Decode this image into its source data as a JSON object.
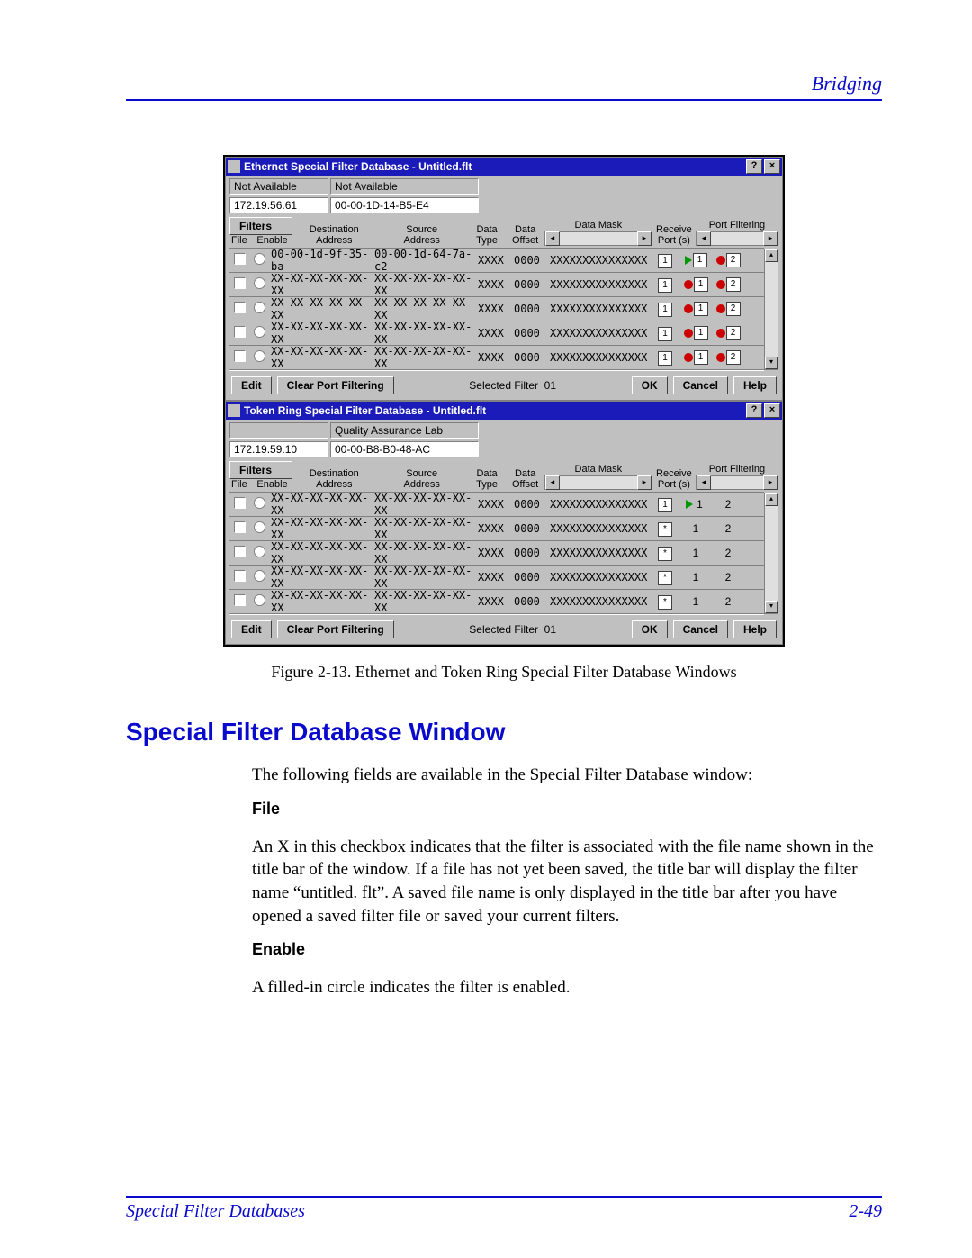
{
  "header": {
    "section": "Bridging"
  },
  "figure_caption": "Figure 2-13. Ethernet and Token Ring Special Filter Database Windows",
  "section_title": "Special Filter Database Window",
  "intro": "The following fields are available in the Special Filter Database window:",
  "fields": {
    "file": {
      "name": "File",
      "desc": "An X in this checkbox indicates that the filter is associated with the file name shown in the title bar of the window. If a file has not yet been saved, the title bar will display the filter name “untitled. flt”. A saved file name is only displayed in the title bar after you have opened a saved filter file or saved your current filters."
    },
    "enable": {
      "name": "Enable",
      "desc": "A filled-in circle indicates the filter is enabled."
    }
  },
  "footer": {
    "left": "Special Filter Databases",
    "right": "2-49"
  },
  "strings": {
    "filters_btn": "Filters",
    "edit_btn": "Edit",
    "clear_btn": "Clear Port Filtering",
    "ok_btn": "OK",
    "cancel_btn": "Cancel",
    "help_btn": "Help",
    "selected_label": "Selected Filter",
    "selected_value": "01",
    "hdr_file": "File",
    "hdr_enable": "Enable",
    "hdr_dest1": "Destination",
    "hdr_dest2": "Address",
    "hdr_src1": "Source",
    "hdr_src2": "Address",
    "hdr_dtype1": "Data",
    "hdr_dtype2": "Type",
    "hdr_doff1": "Data",
    "hdr_doff2": "Offset",
    "hdr_mask": "Data Mask",
    "hdr_recv1": "Receive",
    "hdr_recv2": "Port (s)",
    "hdr_pf": "Port Filtering"
  },
  "dialogs": [
    {
      "title": "Ethernet Special Filter Database - Untitled.flt",
      "dev_name": "Not Available",
      "dev_mac_label": "Not Available",
      "dev_ip": "172.19.56.61",
      "dev_mac": "00-00-1D-14-B5-E4",
      "port_boxed": true,
      "rows": [
        {
          "da": "00-00-1d-9f-35-ba",
          "sa": "00-00-1d-64-7a-c2",
          "dt": "XXXX",
          "do": "0000",
          "dm": "XXXXXXXXXXXXXXX",
          "rp": "1",
          "pf1": {
            "style": "arrow",
            "n": "1"
          },
          "pf2": {
            "style": "red",
            "n": "2"
          }
        },
        {
          "da": "XX-XX-XX-XX-XX-XX",
          "sa": "XX-XX-XX-XX-XX-XX",
          "dt": "XXXX",
          "do": "0000",
          "dm": "XXXXXXXXXXXXXXX",
          "rp": "1",
          "pf1": {
            "style": "red",
            "n": "1"
          },
          "pf2": {
            "style": "red",
            "n": "2"
          }
        },
        {
          "da": "XX-XX-XX-XX-XX-XX",
          "sa": "XX-XX-XX-XX-XX-XX",
          "dt": "XXXX",
          "do": "0000",
          "dm": "XXXXXXXXXXXXXXX",
          "rp": "1",
          "pf1": {
            "style": "red",
            "n": "1"
          },
          "pf2": {
            "style": "red",
            "n": "2"
          }
        },
        {
          "da": "XX-XX-XX-XX-XX-XX",
          "sa": "XX-XX-XX-XX-XX-XX",
          "dt": "XXXX",
          "do": "0000",
          "dm": "XXXXXXXXXXXXXXX",
          "rp": "1",
          "pf1": {
            "style": "red",
            "n": "1"
          },
          "pf2": {
            "style": "red",
            "n": "2"
          }
        },
        {
          "da": "XX-XX-XX-XX-XX-XX",
          "sa": "XX-XX-XX-XX-XX-XX",
          "dt": "XXXX",
          "do": "0000",
          "dm": "XXXXXXXXXXXXXXX",
          "rp": "1",
          "pf1": {
            "style": "red",
            "n": "1"
          },
          "pf2": {
            "style": "red",
            "n": "2"
          }
        }
      ]
    },
    {
      "title": "Token Ring Special Filter Database - Untitled.flt",
      "dev_name": "",
      "dev_mac_label": "Quality Assurance Lab",
      "dev_ip": "172.19.59.10",
      "dev_mac": "00-00-B8-B0-48-AC",
      "port_boxed": false,
      "rows": [
        {
          "da": "XX-XX-XX-XX-XX-XX",
          "sa": "XX-XX-XX-XX-XX-XX",
          "dt": "XXXX",
          "do": "0000",
          "dm": "XXXXXXXXXXXXXXX",
          "rp": "1",
          "pf1": {
            "style": "arrow",
            "n": "1"
          },
          "pf2": {
            "style": "plain",
            "n": "2"
          }
        },
        {
          "da": "XX-XX-XX-XX-XX-XX",
          "sa": "XX-XX-XX-XX-XX-XX",
          "dt": "XXXX",
          "do": "0000",
          "dm": "XXXXXXXXXXXXXXX",
          "rp": "*",
          "pf1": {
            "style": "plain",
            "n": "1"
          },
          "pf2": {
            "style": "plain",
            "n": "2"
          }
        },
        {
          "da": "XX-XX-XX-XX-XX-XX",
          "sa": "XX-XX-XX-XX-XX-XX",
          "dt": "XXXX",
          "do": "0000",
          "dm": "XXXXXXXXXXXXXXX",
          "rp": "*",
          "pf1": {
            "style": "plain",
            "n": "1"
          },
          "pf2": {
            "style": "plain",
            "n": "2"
          }
        },
        {
          "da": "XX-XX-XX-XX-XX-XX",
          "sa": "XX-XX-XX-XX-XX-XX",
          "dt": "XXXX",
          "do": "0000",
          "dm": "XXXXXXXXXXXXXXX",
          "rp": "*",
          "pf1": {
            "style": "plain",
            "n": "1"
          },
          "pf2": {
            "style": "plain",
            "n": "2"
          }
        },
        {
          "da": "XX-XX-XX-XX-XX-XX",
          "sa": "XX-XX-XX-XX-XX-XX",
          "dt": "XXXX",
          "do": "0000",
          "dm": "XXXXXXXXXXXXXXX",
          "rp": "*",
          "pf1": {
            "style": "plain",
            "n": "1"
          },
          "pf2": {
            "style": "plain",
            "n": "2"
          }
        }
      ]
    }
  ]
}
